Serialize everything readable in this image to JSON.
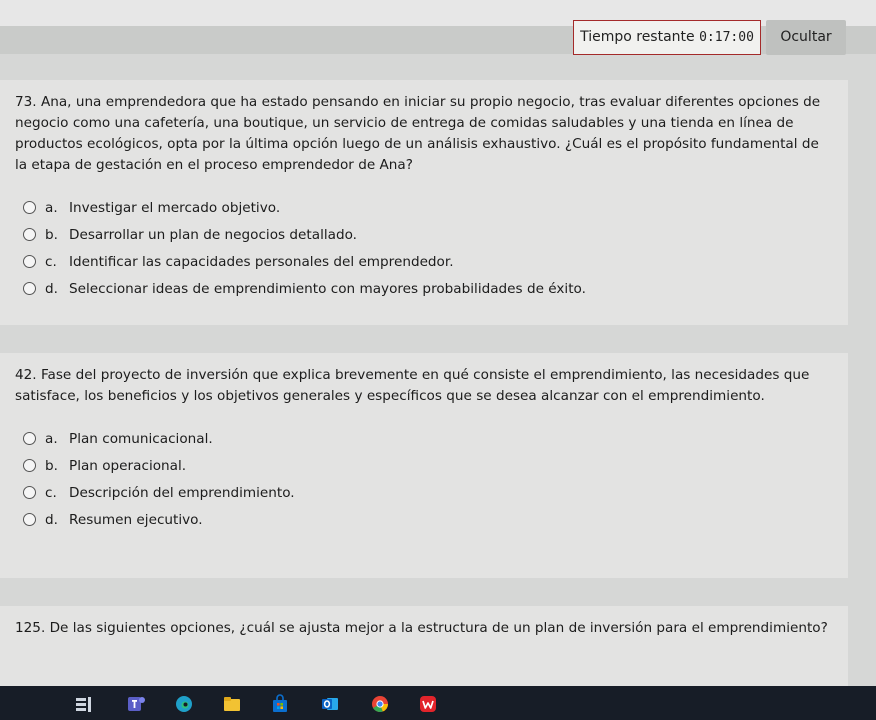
{
  "timer": {
    "label": "Tiempo restante",
    "value": "0:17:00"
  },
  "hide_button": "Ocultar",
  "questions": [
    {
      "text": "73. Ana, una emprendedora que ha estado pensando en iniciar su propio negocio, tras evaluar diferentes opciones de negocio como una cafetería, una boutique, un servicio de entrega de comidas saludables y una tienda en línea de productos ecológicos, opta por la última opción luego de un análisis exhaustivo. ¿Cuál es el propósito fundamental de la etapa de gestación en el proceso emprendedor de Ana?",
      "options": [
        {
          "letter": "a.",
          "text": "Investigar el mercado objetivo."
        },
        {
          "letter": "b.",
          "text": "Desarrollar un plan de negocios detallado."
        },
        {
          "letter": "c.",
          "text": "Identificar las capacidades personales del emprendedor."
        },
        {
          "letter": "d.",
          "text": "Seleccionar ideas de emprendimiento con mayores probabilidades de éxito."
        }
      ]
    },
    {
      "text": "42. Fase del proyecto de inversión que explica brevemente en qué consiste el emprendimiento, las necesidades que satisface, los beneficios y los objetivos generales y específicos que se desea alcanzar con el emprendimiento.",
      "options": [
        {
          "letter": "a.",
          "text": "Plan comunicacional."
        },
        {
          "letter": "b.",
          "text": "Plan operacional."
        },
        {
          "letter": "c.",
          "text": "Descripción del emprendimiento."
        },
        {
          "letter": "d.",
          "text": "Resumen ejecutivo."
        }
      ]
    },
    {
      "text": "125. De las siguientes opciones, ¿cuál se ajusta mejor a la estructura de un plan de inversión para el emprendimiento?"
    }
  ],
  "taskbar": {
    "icons": [
      "task-view-icon",
      "teams-icon",
      "edge-icon",
      "file-explorer-icon",
      "store-icon",
      "outlook-icon",
      "chrome-icon",
      "wps-office-icon"
    ],
    "colors": {
      "background": "#171d27",
      "teams": "#5b5fc7",
      "edge": "#1fa0c9",
      "explorer": "#f2c233",
      "store": "#0b6fcf",
      "outlook": "#0a64c4",
      "chrome": "#e94335",
      "wps": "#e2242b"
    }
  }
}
